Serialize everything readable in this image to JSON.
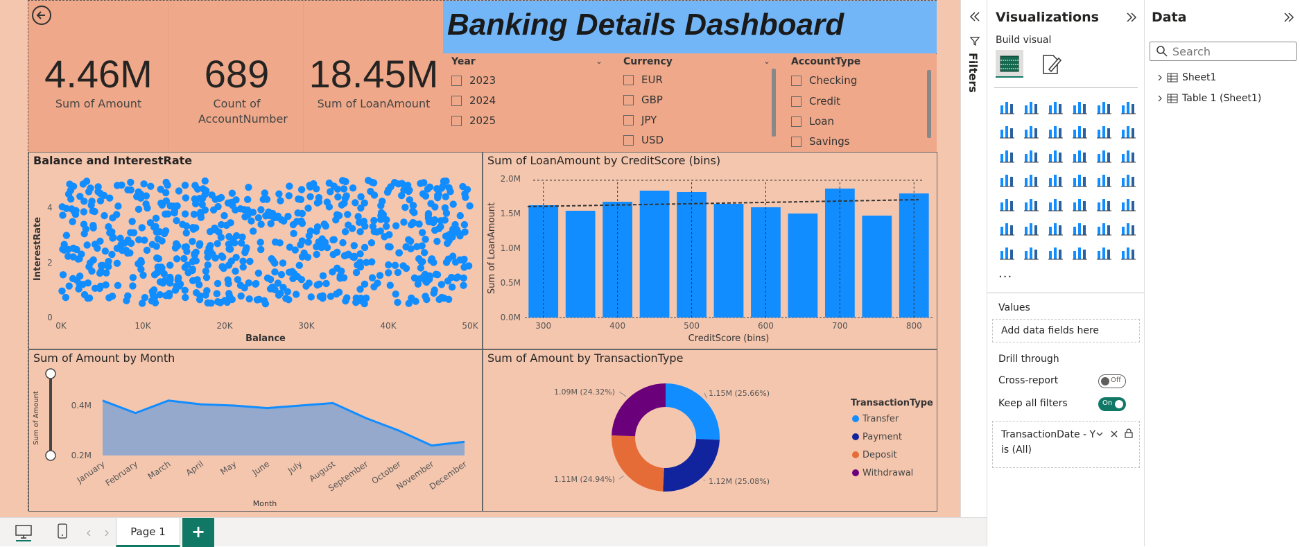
{
  "report": {
    "title": "Banking Details Dashboard",
    "back_icon": "back-arrow-icon",
    "kpis": [
      {
        "value": "4.46M",
        "label": "Sum of Amount"
      },
      {
        "value": "689",
        "label": "Count of AccountNumber"
      },
      {
        "value": "18.45M",
        "label": "Sum of LoanAmount"
      }
    ],
    "slicers": {
      "year": {
        "header": "Year",
        "items": [
          "2023",
          "2024",
          "2025"
        ]
      },
      "currency": {
        "header": "Currency",
        "items": [
          "EUR",
          "GBP",
          "JPY",
          "USD"
        ]
      },
      "accounttype": {
        "header": "AccountType",
        "items": [
          "Checking",
          "Credit",
          "Loan",
          "Savings"
        ]
      }
    }
  },
  "charts": {
    "scatter_title": "Balance and InterestRate",
    "bar_title": "Sum of LoanAmount by CreditScore (bins)",
    "line_title": "Sum of Amount by Month",
    "donut_title": "Sum of Amount by TransactionType"
  },
  "chart_data": [
    {
      "type": "scatter",
      "title": "Balance and InterestRate",
      "xlabel": "Balance",
      "ylabel": "InterestRate",
      "xlim": [
        0,
        50000
      ],
      "ylim": [
        0,
        5
      ],
      "xticks": [
        "0K",
        "10K",
        "20K",
        "30K",
        "40K",
        "50K"
      ],
      "yticks": [
        "0",
        "2",
        "4"
      ],
      "point_count": 689,
      "distribution": "uniform, balance 0–50K, interest rate 0.5–5"
    },
    {
      "type": "bar",
      "title": "Sum of LoanAmount by CreditScore (bins)",
      "xlabel": "CreditScore (bins)",
      "ylabel": "Sum of LoanAmount",
      "categories": [
        "300",
        "350",
        "400",
        "450",
        "500",
        "550",
        "600",
        "650",
        "700",
        "750",
        "800"
      ],
      "xticks": [
        "300",
        "400",
        "500",
        "600",
        "700",
        "800"
      ],
      "values": [
        1.62,
        1.54,
        1.67,
        1.83,
        1.81,
        1.64,
        1.59,
        1.5,
        1.86,
        1.47,
        1.79
      ],
      "unit": "M",
      "ylim": [
        0,
        2.0
      ],
      "yticks": [
        "0.0M",
        "0.5M",
        "1.0M",
        "1.5M",
        "2.0M"
      ],
      "trend_line": [
        1.6,
        1.7
      ]
    },
    {
      "type": "area",
      "title": "Sum of Amount by Month",
      "xlabel": "Month",
      "ylabel": "Sum of Amount",
      "categories": [
        "January",
        "February",
        "March",
        "April",
        "May",
        "June",
        "July",
        "August",
        "September",
        "October",
        "November",
        "December"
      ],
      "values": [
        0.42,
        0.37,
        0.42,
        0.405,
        0.4,
        0.39,
        0.4,
        0.41,
        0.35,
        0.3,
        0.24,
        0.255
      ],
      "unit": "M",
      "yticks": [
        "0.2M",
        "0.4M"
      ],
      "ylim": [
        0.2,
        0.5
      ]
    },
    {
      "type": "pie",
      "title": "Sum of Amount by TransactionType",
      "legend_title": "TransactionType",
      "legend_position": "right",
      "slices": [
        {
          "name": "Transfer",
          "value": 1.15,
          "pct": 25.66,
          "label": "1.15M (25.66%)",
          "color": "#118dff"
        },
        {
          "name": "Payment",
          "value": 1.12,
          "pct": 25.08,
          "label": "1.12M (25.08%)",
          "color": "#12239e"
        },
        {
          "name": "Deposit",
          "value": 1.11,
          "pct": 24.94,
          "label": "1.11M (24.94%)",
          "color": "#e66c37"
        },
        {
          "name": "Withdrawal",
          "value": 1.09,
          "pct": 24.32,
          "label": "1.09M (24.32%)",
          "color": "#6b007b"
        }
      ]
    }
  ],
  "filters": {
    "label": "Filters"
  },
  "visualizations": {
    "title": "Visualizations",
    "build_visual": "Build visual",
    "values_label": "Values",
    "add_fields": "Add data fields here",
    "drill_through": "Drill through",
    "cross_report": "Cross-report",
    "cross_report_state": "Off",
    "keep_all_filters": "Keep all filters",
    "keep_all_filters_state": "On",
    "filter_card_line1": "TransactionDate - Y",
    "filter_card_line2": "is (All)",
    "more": "..."
  },
  "data_pane": {
    "title": "Data",
    "search_placeholder": "Search",
    "tables": [
      "Sheet1",
      "Table 1 (Sheet1)"
    ]
  },
  "pages": {
    "tab": "Page 1",
    "add": "+"
  },
  "colors": {
    "accent": "#118dff",
    "canvas": "#f4c6ae",
    "report": "#efa98a",
    "title_bg": "#73b6f7",
    "toggle_on": "#117865"
  }
}
